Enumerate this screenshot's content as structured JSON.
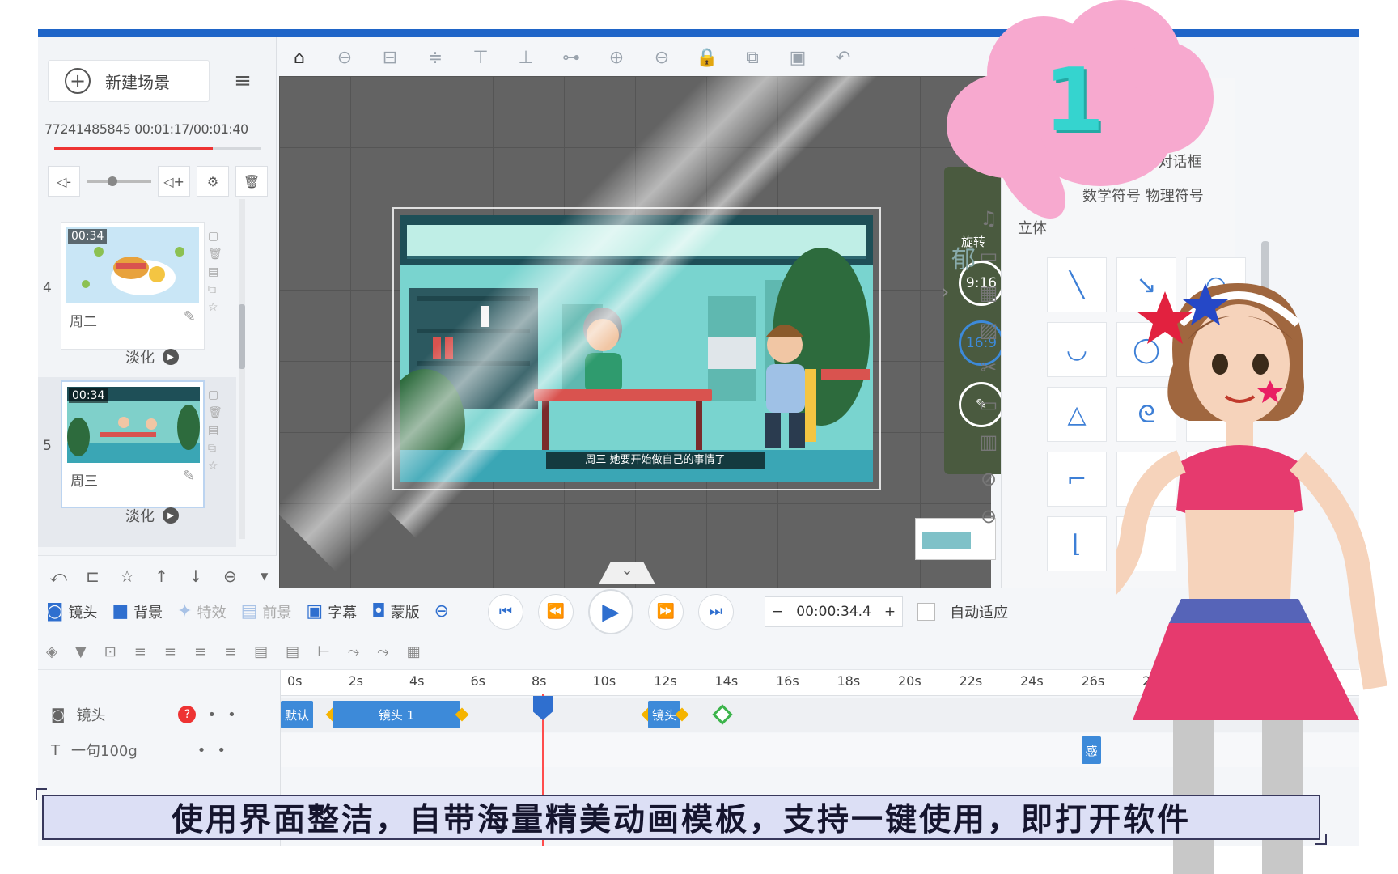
{
  "left_panel": {
    "new_scene_label": "新建场景",
    "scene_info": "77241485845  00:01:17/00:01:40",
    "progress_fraction": 0.77,
    "scenes": [
      {
        "number": "4",
        "duration": "00:34",
        "name": "周二",
        "transition": "淡化"
      },
      {
        "number": "5",
        "duration": "00:34",
        "name": "周三",
        "transition": "淡化"
      }
    ]
  },
  "canvas": {
    "stage_subtitle": "周三 她要开始做自己的事情了",
    "props_label": "旋转",
    "ratio_916": "9:16",
    "ratio_169": "16:9"
  },
  "right_panel": {
    "shape_tabs_row1": "矩形  圆形  对话框",
    "shape_tabs_row2": "数学符号  物理符号",
    "shape_tab_row3": "立体",
    "peek_text": "郁"
  },
  "timeline": {
    "tools": [
      {
        "icon": "camera-icon",
        "label": "镜头",
        "dim": false
      },
      {
        "icon": "background-icon",
        "label": "背景",
        "dim": false
      },
      {
        "icon": "effect-icon",
        "label": "特效",
        "dim": true
      },
      {
        "icon": "mask-icon",
        "label": "前景",
        "dim": true
      },
      {
        "icon": "caption-icon",
        "label": "字幕",
        "dim": false
      },
      {
        "icon": "mask2-icon",
        "label": "蒙版",
        "dim": false
      }
    ],
    "time_value": "00:00:34.4",
    "auto_fit_label": "自动适应",
    "ticks": [
      "0s",
      "2s",
      "4s",
      "6s",
      "8s",
      "10s",
      "12s",
      "14s",
      "16s",
      "18s",
      "20s",
      "22s",
      "24s",
      "26s",
      "28s"
    ],
    "camera_track_label": "镜头",
    "text_track_label": "一句100g",
    "clip_default": "默认",
    "clip_cam1": "镜头 1",
    "clip_cam2": "镜头",
    "clip_right": "感"
  },
  "overlay": {
    "badge_number": "1",
    "caption": "使用界面整洁，自带海量精美动画模板，支持一键使用，即打开软件"
  },
  "colors": {
    "accent": "#2f6fcf",
    "title_bar": "#1f65c8",
    "badge_pink": "#f7a9cf",
    "badge_teal": "#35d4cf"
  }
}
